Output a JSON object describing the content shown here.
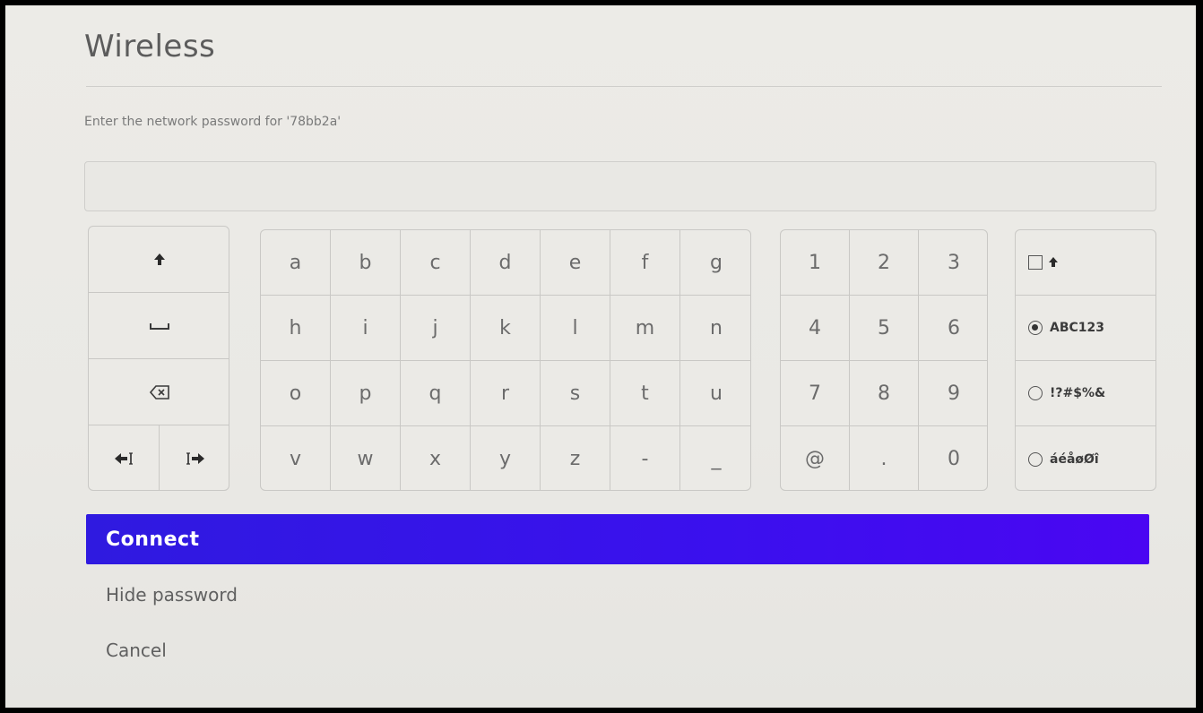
{
  "header": {
    "title": "Wireless"
  },
  "prompt": {
    "text": "Enter the network password for '78bb2a'"
  },
  "password_field": {
    "value": ""
  },
  "keyboard": {
    "control_keys": [
      {
        "name": "shift-key",
        "icon": "arrow-up-icon"
      },
      {
        "name": "space-key",
        "icon": "space-bar-icon"
      },
      {
        "name": "backspace-key",
        "icon": "backspace-icon"
      },
      {
        "name": "cursor-left-key",
        "icon": "cursor-left-icon"
      },
      {
        "name": "cursor-right-key",
        "icon": "cursor-right-icon"
      }
    ],
    "letter_rows": [
      [
        "a",
        "b",
        "c",
        "d",
        "e",
        "f",
        "g"
      ],
      [
        "h",
        "i",
        "j",
        "k",
        "l",
        "m",
        "n"
      ],
      [
        "o",
        "p",
        "q",
        "r",
        "s",
        "t",
        "u"
      ],
      [
        "v",
        "w",
        "x",
        "y",
        "z",
        "-",
        "_"
      ]
    ],
    "number_rows": [
      [
        "1",
        "2",
        "3"
      ],
      [
        "4",
        "5",
        "6"
      ],
      [
        "7",
        "8",
        "9"
      ],
      [
        "@",
        ".",
        "0"
      ]
    ],
    "modes": {
      "caps_lock_icon": "arrow-up-icon",
      "options": [
        {
          "label": "ABC123",
          "selected": true
        },
        {
          "label": "!?#$%&",
          "selected": false
        },
        {
          "label": "áéåøØî",
          "selected": false
        }
      ]
    }
  },
  "actions": {
    "connect": "Connect",
    "hide_password": "Hide password",
    "cancel": "Cancel"
  },
  "colors": {
    "accent": "#3b10ee",
    "background": "#ebeae6",
    "text": "#6b6b6b"
  }
}
